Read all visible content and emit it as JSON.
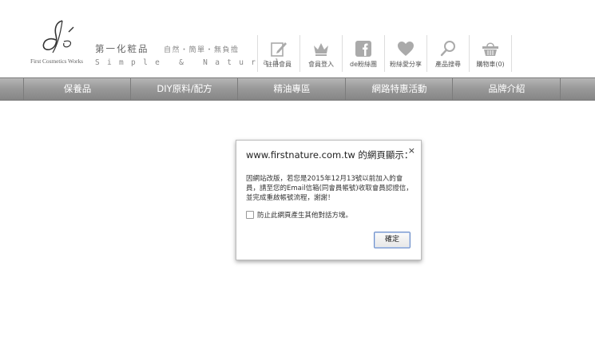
{
  "logo": {
    "mark_text": "dé",
    "subtitle": "First Cosmetics Works",
    "icon": "de-logo-mark"
  },
  "brand": {
    "name": "第一化粧品",
    "tagline": "自然・簡單・無負擔",
    "slogan": "Simple & Natural"
  },
  "top_icons": [
    {
      "label": "註冊會員",
      "icon": "pencil-edit-icon"
    },
    {
      "label": "會員登入",
      "icon": "crown-icon"
    },
    {
      "label": "de粉絲團",
      "icon": "facebook-icon"
    },
    {
      "label": "粉絲愛分享",
      "icon": "heart-icon"
    },
    {
      "label": "產品搜尋",
      "icon": "search-icon"
    },
    {
      "label": "購物車(0)",
      "icon": "cart-basket-icon"
    }
  ],
  "menu": [
    {
      "label": "保養品"
    },
    {
      "label": "DIY原料/配方"
    },
    {
      "label": "精油專區"
    },
    {
      "label": "網路特惠活動"
    },
    {
      "label": "品牌介紹"
    }
  ],
  "dialog": {
    "title": "www.firstnature.com.tw 的網頁顯示：",
    "close": "×",
    "message": "因網站改版，若您是2015年12月13號以前加入的會員，請至您的Email信箱(同會員帳號)收取會員認證信，並完成重啟帳號流程，謝謝！",
    "checkbox_label": "防止此網頁產生其他對話方塊。",
    "ok_label": "確定"
  },
  "colors": {
    "menu_bg": "#9a9a9a",
    "icon_gray": "#b0b0b0",
    "ok_border": "#6c8dc8"
  }
}
